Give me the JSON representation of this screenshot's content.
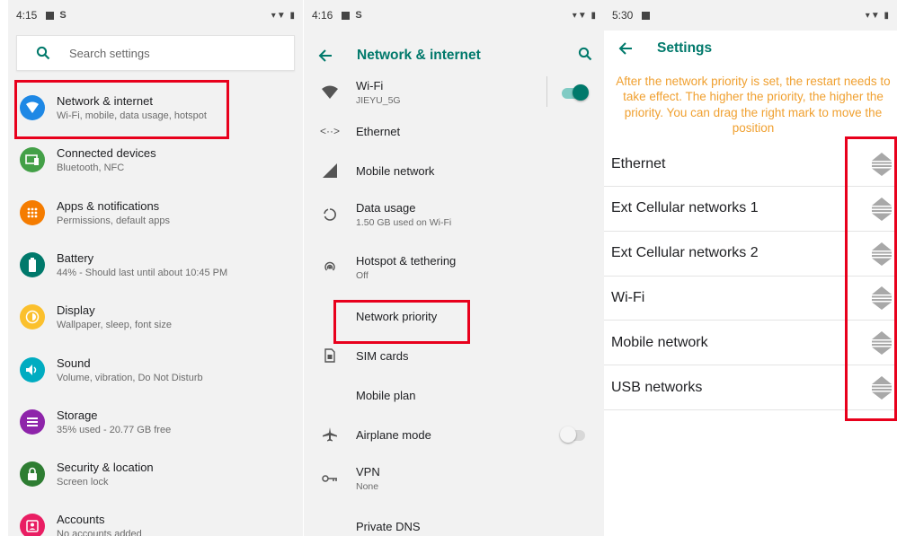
{
  "panel1": {
    "status_time": "4:15",
    "search_placeholder": "Search settings",
    "items": [
      {
        "title": "Network & internet",
        "subtitle": "Wi-Fi, mobile, data usage, hotspot",
        "color": "#1e88e5",
        "icon": "wifi-icon"
      },
      {
        "title": "Connected devices",
        "subtitle": "Bluetooth, NFC",
        "color": "#43a047",
        "icon": "devices-icon"
      },
      {
        "title": "Apps & notifications",
        "subtitle": "Permissions, default apps",
        "color": "#f57c00",
        "icon": "apps-icon"
      },
      {
        "title": "Battery",
        "subtitle": "44% - Should last until about 10:45 PM",
        "color": "#00796b",
        "icon": "battery-icon"
      },
      {
        "title": "Display",
        "subtitle": "Wallpaper, sleep, font size",
        "color": "#fbc02d",
        "icon": "brightness-icon"
      },
      {
        "title": "Sound",
        "subtitle": "Volume, vibration, Do Not Disturb",
        "color": "#00acc1",
        "icon": "volume-icon"
      },
      {
        "title": "Storage",
        "subtitle": "35% used - 20.77 GB free",
        "color": "#8e24aa",
        "icon": "storage-icon"
      },
      {
        "title": "Security & location",
        "subtitle": "Screen lock",
        "color": "#2e7d32",
        "icon": "lock-icon"
      },
      {
        "title": "Accounts",
        "subtitle": "No accounts added",
        "color": "#e91e63",
        "icon": "account-icon"
      }
    ]
  },
  "panel2": {
    "status_time": "4:16",
    "title": "Network & internet",
    "items": [
      {
        "title": "Wi-Fi",
        "subtitle": "JIEYU_5G",
        "icon": "wifi-icon",
        "toggle": true,
        "toggle_on": true
      },
      {
        "title": "Ethernet",
        "subtitle": "",
        "icon": "ethernet-icon"
      },
      {
        "title": "Mobile network",
        "subtitle": "",
        "icon": "signal-icon"
      },
      {
        "title": "Data usage",
        "subtitle": "1.50 GB used on Wi-Fi",
        "icon": "data-usage-icon"
      },
      {
        "title": "Hotspot & tethering",
        "subtitle": "Off",
        "icon": "hotspot-icon"
      },
      {
        "title": "Network priority",
        "subtitle": "",
        "icon": ""
      },
      {
        "title": "SIM cards",
        "subtitle": "",
        "icon": "sim-card-icon"
      },
      {
        "title": "Mobile plan",
        "subtitle": "",
        "icon": ""
      },
      {
        "title": "Airplane mode",
        "subtitle": "",
        "icon": "airplane-icon",
        "toggle": true,
        "toggle_on": false
      },
      {
        "title": "VPN",
        "subtitle": "None",
        "icon": "vpn-key-icon"
      },
      {
        "title": "Private DNS",
        "subtitle": "",
        "icon": ""
      }
    ]
  },
  "panel3": {
    "status_time": "5:30",
    "title": "Settings",
    "note": "After the network priority is set, the restart needs to take effect. The higher the priority, the higher the priority. You can drag the right mark to move the position",
    "items": [
      "Ethernet",
      "Ext Cellular networks 1",
      "Ext Cellular networks 2",
      "Wi-Fi",
      "Mobile network",
      "USB networks"
    ]
  },
  "colors": {
    "accent": "#00796b",
    "highlight": "#e8001c",
    "note": "#f0a030"
  }
}
